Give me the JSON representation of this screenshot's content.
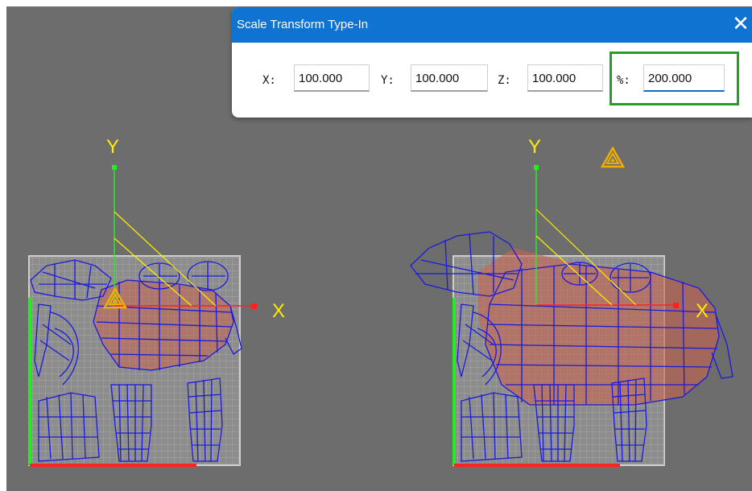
{
  "dialog": {
    "title": "Scale Transform Type-In",
    "close_glyph": "✕",
    "fields": [
      {
        "label": "X:",
        "value": "100.000"
      },
      {
        "label": "Y:",
        "value": "100.000"
      },
      {
        "label": "Z:",
        "value": "100.000"
      },
      {
        "label": "%:",
        "value": "200.000"
      }
    ]
  },
  "viewport": {
    "left_gizmo": {
      "y_axis_label": "Y",
      "x_axis_label": "X"
    },
    "right_gizmo": {
      "y_axis_label": "Y",
      "x_axis_label": "X"
    },
    "colors": {
      "background": "#6d6d6d",
      "mesh": "#1a1adc",
      "x_axis": "#ff2222",
      "y_axis": "#22ee22",
      "gizmo_label": "#ffee00",
      "selection_fill": "#c86450"
    },
    "icons": [
      "pivot-warning-icon"
    ]
  }
}
